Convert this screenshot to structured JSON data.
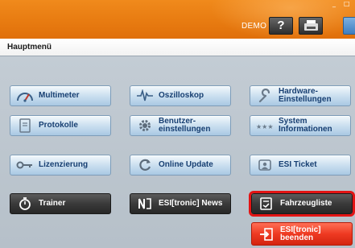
{
  "header": {
    "window_controls": [
      "_",
      "□"
    ],
    "mode": "DEMO",
    "help_label": "?",
    "accent_color": "#e77a10"
  },
  "title": "Hauptmenü",
  "menu": {
    "multimeter": "Multimeter",
    "oszilloskop": "Oszilloskop",
    "hardware": [
      "Hardware-",
      "Einstellungen"
    ],
    "protokolle": "Protokolle",
    "benutzer": [
      "Benutzer-",
      "einstellungen"
    ],
    "system": [
      "System",
      "Informationen"
    ],
    "lizenzierung": "Lizenzierung",
    "online_update": "Online Update",
    "esi_ticket": "ESI Ticket",
    "trainer": "Trainer",
    "news": "ESI[tronic] News",
    "fahrzeugliste": "Fahrzeugliste",
    "beenden": [
      "ESI[tronic]",
      "beenden"
    ]
  },
  "icons": {
    "multimeter": "gauge-icon",
    "oszilloskop": "waveform-icon",
    "hardware": "wrench-icon",
    "protokolle": "document-icon",
    "benutzer": "gear-icon",
    "system": "stars-icon",
    "lizenzierung": "key-icon",
    "online_update": "refresh-icon",
    "esi_ticket": "ticket-icon",
    "trainer": "stopwatch-icon",
    "news": "news-icon",
    "fahrzeugliste": "car-list-icon",
    "beenden": "exit-icon"
  },
  "colors": {
    "header": "#e77a10",
    "primary_button": "#a9c8e3",
    "primary_text": "#173f72",
    "dark_button": "#3a3a3a",
    "exit_button": "#ee3a22",
    "highlight": "#e21414"
  }
}
